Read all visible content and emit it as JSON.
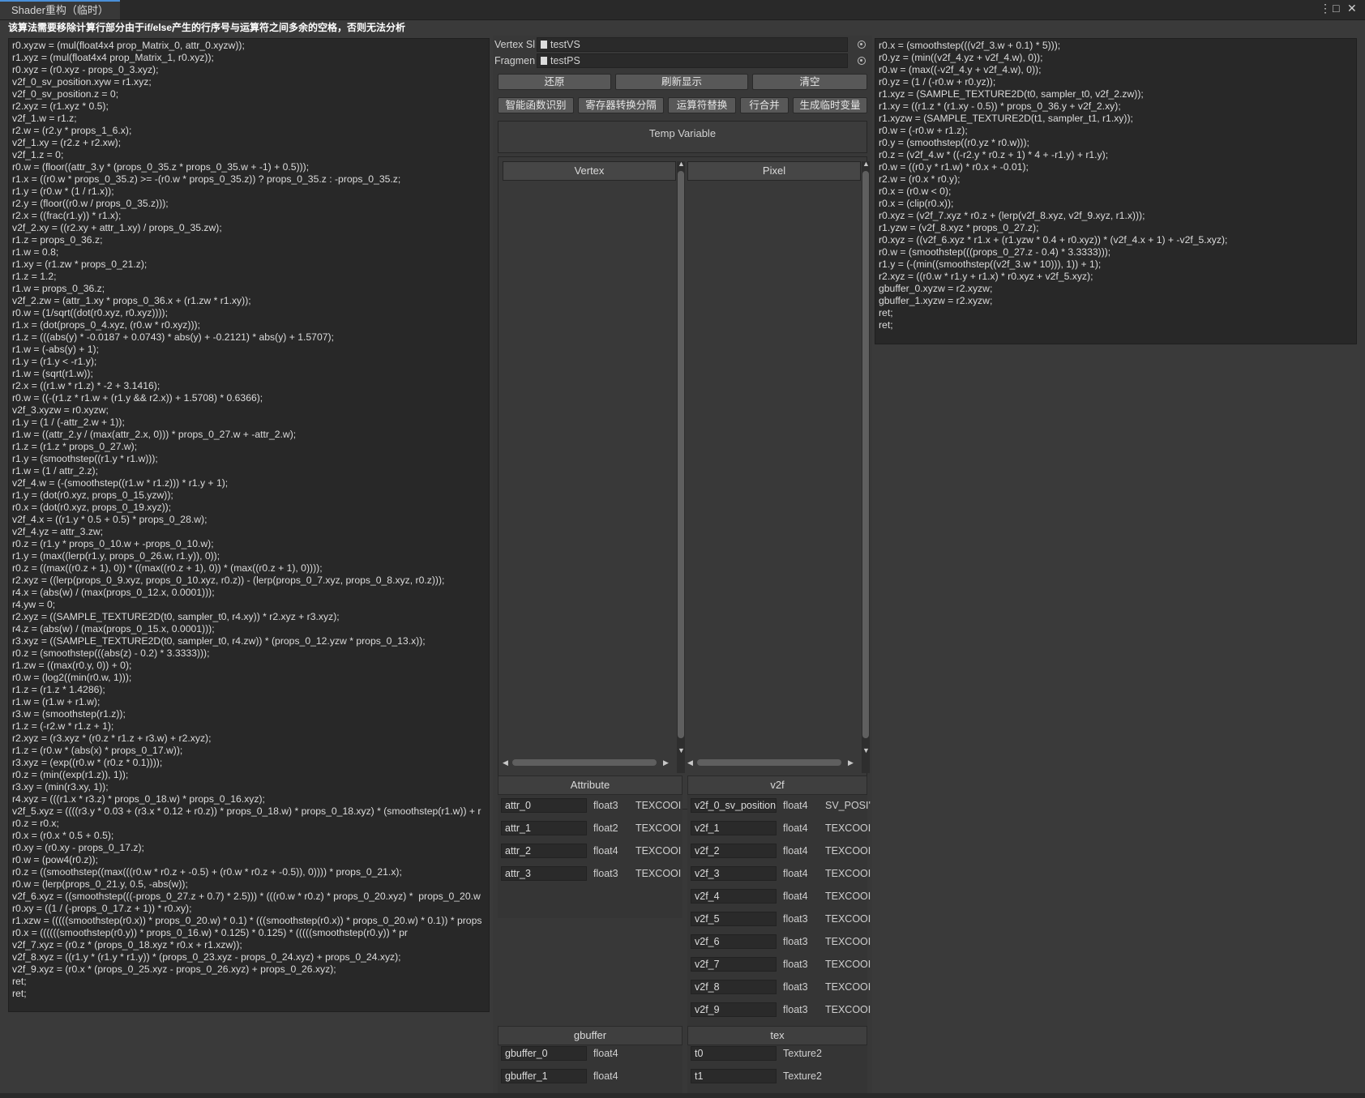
{
  "window": {
    "tab_title": "Shader重构（临时）",
    "warning": "该算法需要移除计算行部分由于if/else产生的行序号与运算符之间多余的空格，否则无法分析"
  },
  "vertex_code": [
    "r0.xyzw = (mul(float4x4 prop_Matrix_0, attr_0.xyzw));",
    "r1.xyz = (mul(float4x4 prop_Matrix_1, r0.xyz));",
    "r0.xyz = (r0.xyz - props_0_3.xyz);",
    "v2f_0_sv_position.xyw = r1.xyz;",
    "v2f_0_sv_position.z = 0;",
    "r2.xyz = (r1.xyz * 0.5);",
    "v2f_1.w = r1.z;",
    "r2.w = (r2.y * props_1_6.x);",
    "v2f_1.xy = (r2.z + r2.xw);",
    "v2f_1.z = 0;",
    "r0.w = (floor((attr_3.y * (props_0_35.z * props_0_35.w + -1) + 0.5)));",
    "r1.x = ((r0.w * props_0_35.z) >= -(r0.w * props_0_35.z)) ? props_0_35.z : -props_0_35.z;",
    "r1.y = (r0.w * (1 / r1.x));",
    "r2.y = (floor((r0.w / props_0_35.z)));",
    "r2.x = ((frac(r1.y)) * r1.x);",
    "v2f_2.xy = ((r2.xy + attr_1.xy) / props_0_35.zw);",
    "r1.z = props_0_36.z;",
    "r1.w = 0.8;",
    "r1.xy = (r1.zw * props_0_21.z);",
    "r1.z = 1.2;",
    "r1.w = props_0_36.z;",
    "v2f_2.zw = (attr_1.xy * props_0_36.x + (r1.zw * r1.xy));",
    "r0.w = (1/sqrt((dot(r0.xyz, r0.xyz))));",
    "r1.x = (dot(props_0_4.xyz, (r0.w * r0.xyz)));",
    "r1.z = (((abs(y) * -0.0187 + 0.0743) * abs(y) + -0.2121) * abs(y) + 1.5707);",
    "r1.w = (-abs(y) + 1);",
    "r1.y = (r1.y < -r1.y);",
    "r1.w = (sqrt(r1.w));",
    "r2.x = ((r1.w * r1.z) * -2 + 3.1416);",
    "r0.w = ((-(r1.z * r1.w + (r1.y && r2.x)) + 1.5708) * 0.6366);",
    "v2f_3.xyzw = r0.xyzw;",
    "r1.y = (1 / (-attr_2.w + 1));",
    "r1.w = ((attr_2.y / (max(attr_2.x, 0))) * props_0_27.w + -attr_2.w);",
    "r1.z = (r1.z * props_0_27.w);",
    "r1.y = (smoothstep((r1.y * r1.w)));",
    "r1.w = (1 / attr_2.z);",
    "v2f_4.w = (-(smoothstep((r1.w * r1.z))) * r1.y + 1);",
    "r1.y = (dot(r0.xyz, props_0_15.yzw));",
    "r0.x = (dot(r0.xyz, props_0_19.xyz));",
    "v2f_4.x = ((r1.y * 0.5 + 0.5) * props_0_28.w);",
    "v2f_4.yz = attr_3.zw;",
    "r0.z = (r1.y * props_0_10.w + -props_0_10.w);",
    "r1.y = (max((lerp(r1.y, props_0_26.w, r1.y)), 0));",
    "r0.z = ((max((r0.z + 1), 0)) * ((max((r0.z + 1), 0)) * (max((r0.z + 1), 0))));",
    "r2.xyz = ((lerp(props_0_9.xyz, props_0_10.xyz, r0.z)) - (lerp(props_0_7.xyz, props_0_8.xyz, r0.z)));",
    "r4.x = (abs(w) / (max(props_0_12.x, 0.0001)));",
    "r4.yw = 0;",
    "r2.xyz = ((SAMPLE_TEXTURE2D(t0, sampler_t0, r4.xy)) * r2.xyz + r3.xyz);",
    "r4.z = (abs(w) / (max(props_0_15.x, 0.0001)));",
    "r3.xyz = ((SAMPLE_TEXTURE2D(t0, sampler_t0, r4.zw)) * (props_0_12.yzw * props_0_13.x));",
    "r0.z = (smoothstep(((abs(z) - 0.2) * 3.3333)));",
    "r1.zw = ((max(r0.y, 0)) + 0);",
    "r0.w = (log2((min(r0.w, 1)));",
    "r1.z = (r1.z * 1.4286);",
    "r1.w = (r1.w + r1.w);",
    "r3.w = (smoothstep(r1.z));",
    "r1.z = (-r2.w * r1.z + 1);",
    "r2.xyz = (r3.xyz * (r0.z * r1.z + r3.w) + r2.xyz);",
    "r1.z = (r0.w * (abs(x) * props_0_17.w));",
    "r3.xyz = (exp((r0.w * (r0.z * 0.1))));",
    "r0.z = (min((exp(r1.z)), 1));",
    "r3.xy = (min(r3.xy, 1));",
    "r4.xyz = (((r1.x * r3.z) * props_0_18.w) * props_0_16.xyz);",
    "v2f_5.xyz = ((((r3.y * 0.03 + (r3.x * 0.12 + r0.z)) * props_0_18.w) * props_0_18.xyz) * (smoothstep(r1.w)) + r",
    "r0.z = r0.x;",
    "r0.x = (r0.x * 0.5 + 0.5);",
    "r0.xy = (r0.xy - props_0_17.z);",
    "r0.w = (pow4(r0.z));",
    "r0.z = ((smoothstep((max(((r0.w * r0.z + -0.5) + (r0.w * r0.z + -0.5)), 0)))) * props_0_21.x);",
    "r0.w = (lerp(props_0_21.y, 0.5, -abs(w));",
    "v2f_6.xyz = ((smoothstep(((-props_0_27.z + 0.7) * 2.5))) * (((r0.w * r0.z) * props_0_20.xyz) *  props_0_20.w",
    "r0.xy = ((1 / (-props_0_17.z + 1)) * r0.xy);",
    "r1.xzw = (((((smoothstep(r0.x)) * props_0_20.w) * 0.1) * (((smoothstep(r0.x)) * props_0_20.w) * 0.1)) * props",
    "r0.x = ((((((smoothstep(r0.y)) * props_0_16.w) * 0.125) * 0.125) * (((((smoothstep(r0.y)) * pr",
    "v2f_7.xyz = (r0.z * (props_0_18.xyz * r0.x + r1.xzw));",
    "v2f_8.xyz = ((r1.y * (r1.y * r1.y)) * (props_0_23.xyz - props_0_24.xyz) + props_0_24.xyz);",
    "v2f_9.xyz = (r0.x * (props_0_25.xyz - props_0_26.xyz) + props_0_26.xyz);",
    "ret;",
    "ret;"
  ],
  "pixel_code": [
    "r0.x = (smoothstep(((v2f_3.w + 0.1) * 5)));",
    "r0.yz = (min((v2f_4.yz + v2f_4.w), 0));",
    "r0.w = (max((-v2f_4.y + v2f_4.w), 0));",
    "r0.yz = (1 / (-r0.w + r0.yz));",
    "r1.xyz = (SAMPLE_TEXTURE2D(t0, sampler_t0, v2f_2.zw));",
    "r1.xy = ((r1.z * (r1.xy - 0.5)) * props_0_36.y + v2f_2.xy);",
    "r1.xyzw = (SAMPLE_TEXTURE2D(t1, sampler_t1, r1.xy));",
    "r0.w = (-r0.w + r1.z);",
    "r0.y = (smoothstep((r0.yz * r0.w)));",
    "r0.z = (v2f_4.w * ((-r2.y * r0.z + 1) * 4 + -r1.y) + r1.y);",
    "r0.w = ((r0.y * r1.w) * r0.x + -0.01);",
    "r2.w = (r0.x * r0.y);",
    "r0.x = (r0.w < 0);",
    "r0.x = (clip(r0.x));",
    "r0.xyz = (v2f_7.xyz * r0.z + (lerp(v2f_8.xyz, v2f_9.xyz, r1.x)));",
    "r1.yzw = (v2f_8.xyz * props_0_27.z);",
    "r0.xyz = ((v2f_6.xyz * r1.x + (r1.yzw * 0.4 + r0.xyz)) * (v2f_4.x + 1) + -v2f_5.xyz);",
    "r0.w = (smoothstep(((props_0_27.z - 0.4) * 3.3333)));",
    "r1.y = (-(min((smoothstep((v2f_3.w * 10))), 1)) + 1);",
    "r2.xyz = ((r0.w * r1.y + r1.x) * r0.xyz + v2f_5.xyz);",
    "gbuffer_0.xyzw = r2.xyzw;",
    "gbuffer_1.xyzw = r2.xyzw;",
    "ret;",
    "ret;"
  ],
  "controls": {
    "vertex_label": "Vertex Sl",
    "vertex_value": "testVS",
    "fragment_label": "Fragmen",
    "fragment_value": "testPS",
    "restore": "还原",
    "refresh": "刷新显示",
    "clear": "清空",
    "smart_func": "智能函数识别",
    "register_split": "寄存器转换分隔",
    "operator_replace": "运算符替换",
    "line_merge": "行合并",
    "gen_temp": "生成临时变量",
    "temp_variable": "Temp Variable",
    "vertex_tab": "Vertex",
    "pixel_tab": "Pixel"
  },
  "attribute": {
    "title": "Attribute",
    "rows": [
      {
        "name": "attr_0",
        "type": "float3",
        "sem": "TEXCOOI"
      },
      {
        "name": "attr_1",
        "type": "float2",
        "sem": "TEXCOOI"
      },
      {
        "name": "attr_2",
        "type": "float4",
        "sem": "TEXCOOI"
      },
      {
        "name": "attr_3",
        "type": "float3",
        "sem": "TEXCOOI"
      }
    ]
  },
  "v2f": {
    "title": "v2f",
    "rows": [
      {
        "name": "v2f_0_sv_position",
        "type": "float4",
        "sem": "SV_POSI'"
      },
      {
        "name": "v2f_1",
        "type": "float4",
        "sem": "TEXCOOI"
      },
      {
        "name": "v2f_2",
        "type": "float4",
        "sem": "TEXCOOI"
      },
      {
        "name": "v2f_3",
        "type": "float4",
        "sem": "TEXCOOI"
      },
      {
        "name": "v2f_4",
        "type": "float4",
        "sem": "TEXCOOI"
      },
      {
        "name": "v2f_5",
        "type": "float3",
        "sem": "TEXCOOI"
      },
      {
        "name": "v2f_6",
        "type": "float3",
        "sem": "TEXCOOI"
      },
      {
        "name": "v2f_7",
        "type": "float3",
        "sem": "TEXCOOI"
      },
      {
        "name": "v2f_8",
        "type": "float3",
        "sem": "TEXCOOI"
      },
      {
        "name": "v2f_9",
        "type": "float3",
        "sem": "TEXCOOI"
      }
    ]
  },
  "gbuffer": {
    "title": "gbuffer",
    "rows": [
      {
        "name": "gbuffer_0",
        "type": "float4"
      },
      {
        "name": "gbuffer_1",
        "type": "float4"
      }
    ]
  },
  "tex": {
    "title": "tex",
    "rows": [
      {
        "name": "t0",
        "type": "Texture2"
      },
      {
        "name": "t1",
        "type": "Texture2"
      }
    ]
  }
}
